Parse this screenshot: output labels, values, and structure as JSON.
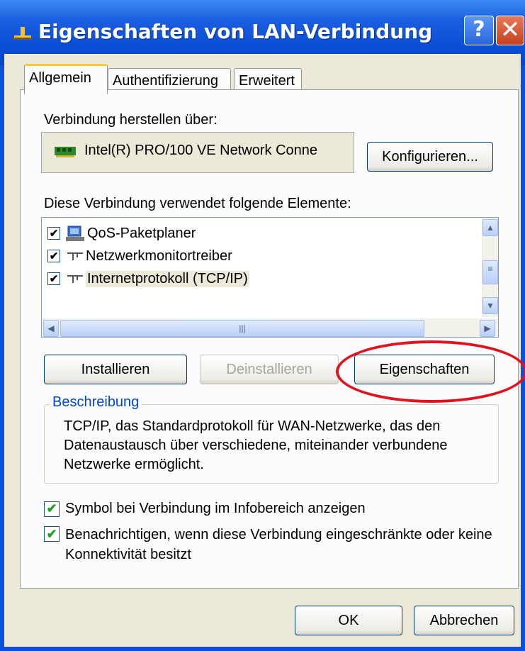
{
  "window": {
    "title": "Eigenschaften von LAN-Verbindung",
    "help_label": "?",
    "close_label": "✕"
  },
  "tabs": [
    {
      "label": "Allgemein",
      "active": true
    },
    {
      "label": "Authentifizierung",
      "active": false
    },
    {
      "label": "Erweitert",
      "active": false
    }
  ],
  "general": {
    "connect_via_label": "Verbindung herstellen über:",
    "adapter_name": "Intel(R) PRO/100 VE Network Conne",
    "configure_button": "Konfigurieren...",
    "components_label": "Diese Verbindung verwendet folgende Elemente:",
    "components": [
      {
        "label": "QoS-Paketplaner",
        "checked": true,
        "icon": "network-computer-icon"
      },
      {
        "label": "Netzwerkmonitortreiber",
        "checked": true,
        "icon": "network-protocol-icon"
      },
      {
        "label": "Internetprotokoll (TCP/IP)",
        "checked": true,
        "icon": "network-protocol-icon",
        "selected": true
      }
    ],
    "install_button": "Installieren",
    "uninstall_button": "Deinstallieren",
    "properties_button": "Eigenschaften",
    "description_title": "Beschreibung",
    "description_text": "TCP/IP, das Standardprotokoll für WAN-Netzwerke, das den Datenaustausch über verschiedene, miteinander verbundene Netzwerke ermöglicht.",
    "show_icon_checkbox": {
      "label": "Symbol bei Verbindung im Infobereich anzeigen",
      "checked": true
    },
    "notify_checkbox": {
      "label": "Benachrichtigen, wenn diese Verbindung eingeschränkte oder keine Konnektivität besitzt",
      "checked": true
    }
  },
  "footer": {
    "ok_button": "OK",
    "cancel_button": "Abbrechen"
  },
  "colors": {
    "titlebar": "#0a4ed6",
    "dialog_bg": "#ece9d8",
    "highlight_circle": "#e0131e"
  }
}
